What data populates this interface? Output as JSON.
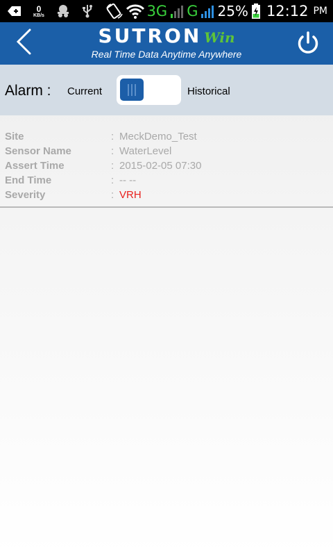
{
  "status_bar": {
    "kb_value": "0",
    "kb_unit": "KB/s",
    "network_3g": "3G",
    "network_g": "G",
    "battery_percent": "25%",
    "time": "12:12",
    "ampm": "PM"
  },
  "header": {
    "brand": "SUTRON",
    "brand_suffix": "Win",
    "tagline": "Real Time Data Anytime Anywhere",
    "colors": {
      "bar": "#1b5fa8",
      "win_green": "#5fc438"
    }
  },
  "alarm": {
    "label": "Alarm :",
    "current_label": "Current",
    "historical_label": "Historical",
    "selected": "Current"
  },
  "details": {
    "rows": [
      {
        "label": "Site",
        "value": "MeckDemo_Test"
      },
      {
        "label": "Sensor Name",
        "value": "WaterLevel"
      },
      {
        "label": "Assert Time",
        "value": "2015-02-05 07:30"
      },
      {
        "label": "End Time",
        "value": "-- --"
      },
      {
        "label": "Severity",
        "value": "VRH"
      }
    ],
    "separator": ":"
  }
}
